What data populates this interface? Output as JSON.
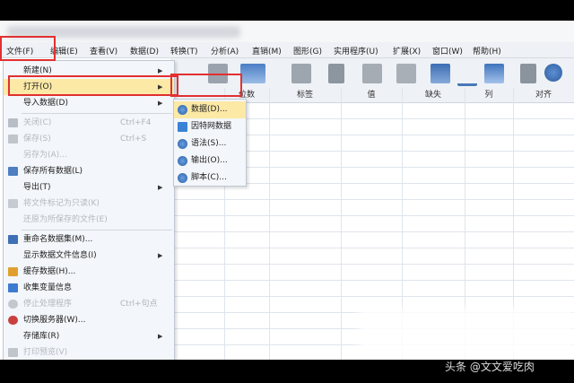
{
  "menubar": {
    "items": [
      {
        "label": "文件(F)"
      },
      {
        "label": "编辑(E)"
      },
      {
        "label": "查看(V)"
      },
      {
        "label": "数据(D)"
      },
      {
        "label": "转换(T)"
      },
      {
        "label": "分析(A)"
      },
      {
        "label": "直销(M)"
      },
      {
        "label": "图形(G)"
      },
      {
        "label": "实用程序(U)"
      },
      {
        "label": "扩展(X)"
      },
      {
        "label": "窗口(W)"
      },
      {
        "label": "帮助(H)"
      }
    ]
  },
  "grid": {
    "columns": [
      "位数",
      "标签",
      "值",
      "缺失",
      "列",
      "对齐"
    ]
  },
  "file_menu": {
    "items": [
      {
        "label": "新建(N)",
        "arrow": "▶"
      },
      {
        "label": "打开(O)",
        "arrow": "▶"
      },
      {
        "label": "导入数据(D)",
        "arrow": "▶"
      },
      {
        "label": "关闭(C)",
        "shortcut": "Ctrl+F4"
      },
      {
        "label": "保存(S)",
        "shortcut": "Ctrl+S"
      },
      {
        "label": "另存为(A)..."
      },
      {
        "label": "保存所有数据(L)"
      },
      {
        "label": "导出(T)",
        "arrow": "▶"
      },
      {
        "label": "将文件标记为只读(K)"
      },
      {
        "label": "还原为所保存的文件(E)"
      },
      {
        "label": "重命名数据集(M)..."
      },
      {
        "label": "显示数据文件信息(I)",
        "arrow": "▶"
      },
      {
        "label": "缓存数据(H)..."
      },
      {
        "label": "收集变量信息"
      },
      {
        "label": "停止处理程序",
        "shortcut": "Ctrl+句点"
      },
      {
        "label": "切换服务器(W)..."
      },
      {
        "label": "存储库(R)",
        "arrow": "▶"
      },
      {
        "label": "打印预览(V)"
      }
    ]
  },
  "open_submenu": {
    "items": [
      {
        "label": "数据(D)..."
      },
      {
        "label": "因特网数据"
      },
      {
        "label": "语法(S)..."
      },
      {
        "label": "输出(O)..."
      },
      {
        "label": "脚本(C)..."
      }
    ]
  },
  "watermark": "头条 @文文爱吃肉",
  "colors": {
    "highlight_red": "#e23030",
    "menu_bg": "#f3f6fa",
    "hover_yellow": "#fce9a6"
  }
}
